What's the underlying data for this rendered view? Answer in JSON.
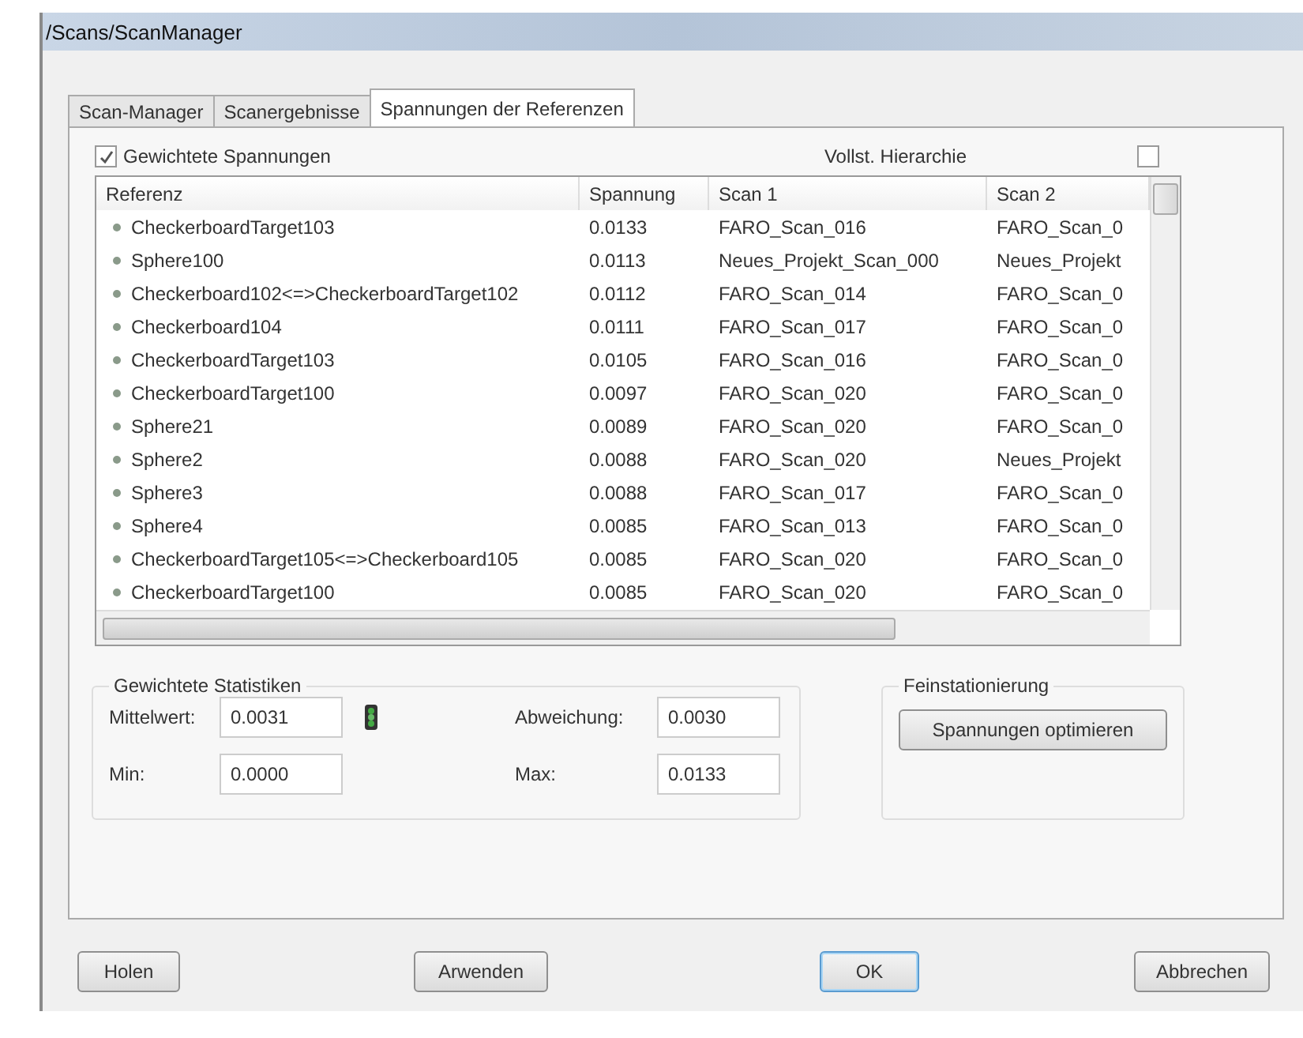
{
  "window": {
    "title": "/Scans/ScanManager"
  },
  "tabs": [
    {
      "label": "Scan-Manager",
      "selected": false
    },
    {
      "label": "Scanergebnisse",
      "selected": false
    },
    {
      "label": "Spannungen der Referenzen",
      "selected": true
    }
  ],
  "options": [
    {
      "label": "Gewichtete Spannungen",
      "checked": true
    },
    {
      "label": "Vollst. Hierarchie",
      "checked": false
    }
  ],
  "table": {
    "columns": [
      "Referenz",
      "Spannung",
      "Scan 1",
      "Scan 2"
    ],
    "rows": [
      [
        "CheckerboardTarget103",
        "0.0133",
        "FARO_Scan_016",
        "FARO_Scan_0"
      ],
      [
        "Sphere100",
        "0.0113",
        "Neues_Projekt_Scan_000",
        "Neues_Projekt"
      ],
      [
        "Checkerboard102<=>CheckerboardTarget102",
        "0.0112",
        "FARO_Scan_014",
        "FARO_Scan_0"
      ],
      [
        "Checkerboard104",
        "0.0111",
        "FARO_Scan_017",
        "FARO_Scan_0"
      ],
      [
        "CheckerboardTarget103",
        "0.0105",
        "FARO_Scan_016",
        "FARO_Scan_0"
      ],
      [
        "CheckerboardTarget100",
        "0.0097",
        "FARO_Scan_020",
        "FARO_Scan_0"
      ],
      [
        "Sphere21",
        "0.0089",
        "FARO_Scan_020",
        "FARO_Scan_0"
      ],
      [
        "Sphere2",
        "0.0088",
        "FARO_Scan_020",
        "Neues_Projekt"
      ],
      [
        "Sphere3",
        "0.0088",
        "FARO_Scan_017",
        "FARO_Scan_0"
      ],
      [
        "Sphere4",
        "0.0085",
        "FARO_Scan_013",
        "FARO_Scan_0"
      ],
      [
        "CheckerboardTarget105<=>Checkerboard105",
        "0.0085",
        "FARO_Scan_020",
        "FARO_Scan_0"
      ],
      [
        "CheckerboardTarget100",
        "0.0085",
        "FARO_Scan_020",
        "FARO_Scan_0"
      ]
    ]
  },
  "statistics": {
    "title": "Gewichtete Statistiken",
    "fields": [
      {
        "label": "Mittelwert:",
        "value": "0.0031"
      },
      {
        "label": "Abweichung:",
        "value": "0.0030"
      },
      {
        "label": "Min:",
        "value": "0.0000"
      },
      {
        "label": "Max:",
        "value": "0.0133"
      }
    ]
  },
  "fine": {
    "title": "Feinstationierung",
    "button": "Spannungen optimieren"
  },
  "buttons": [
    "Holen",
    "Arwenden",
    "OK",
    "Abbrechen"
  ]
}
